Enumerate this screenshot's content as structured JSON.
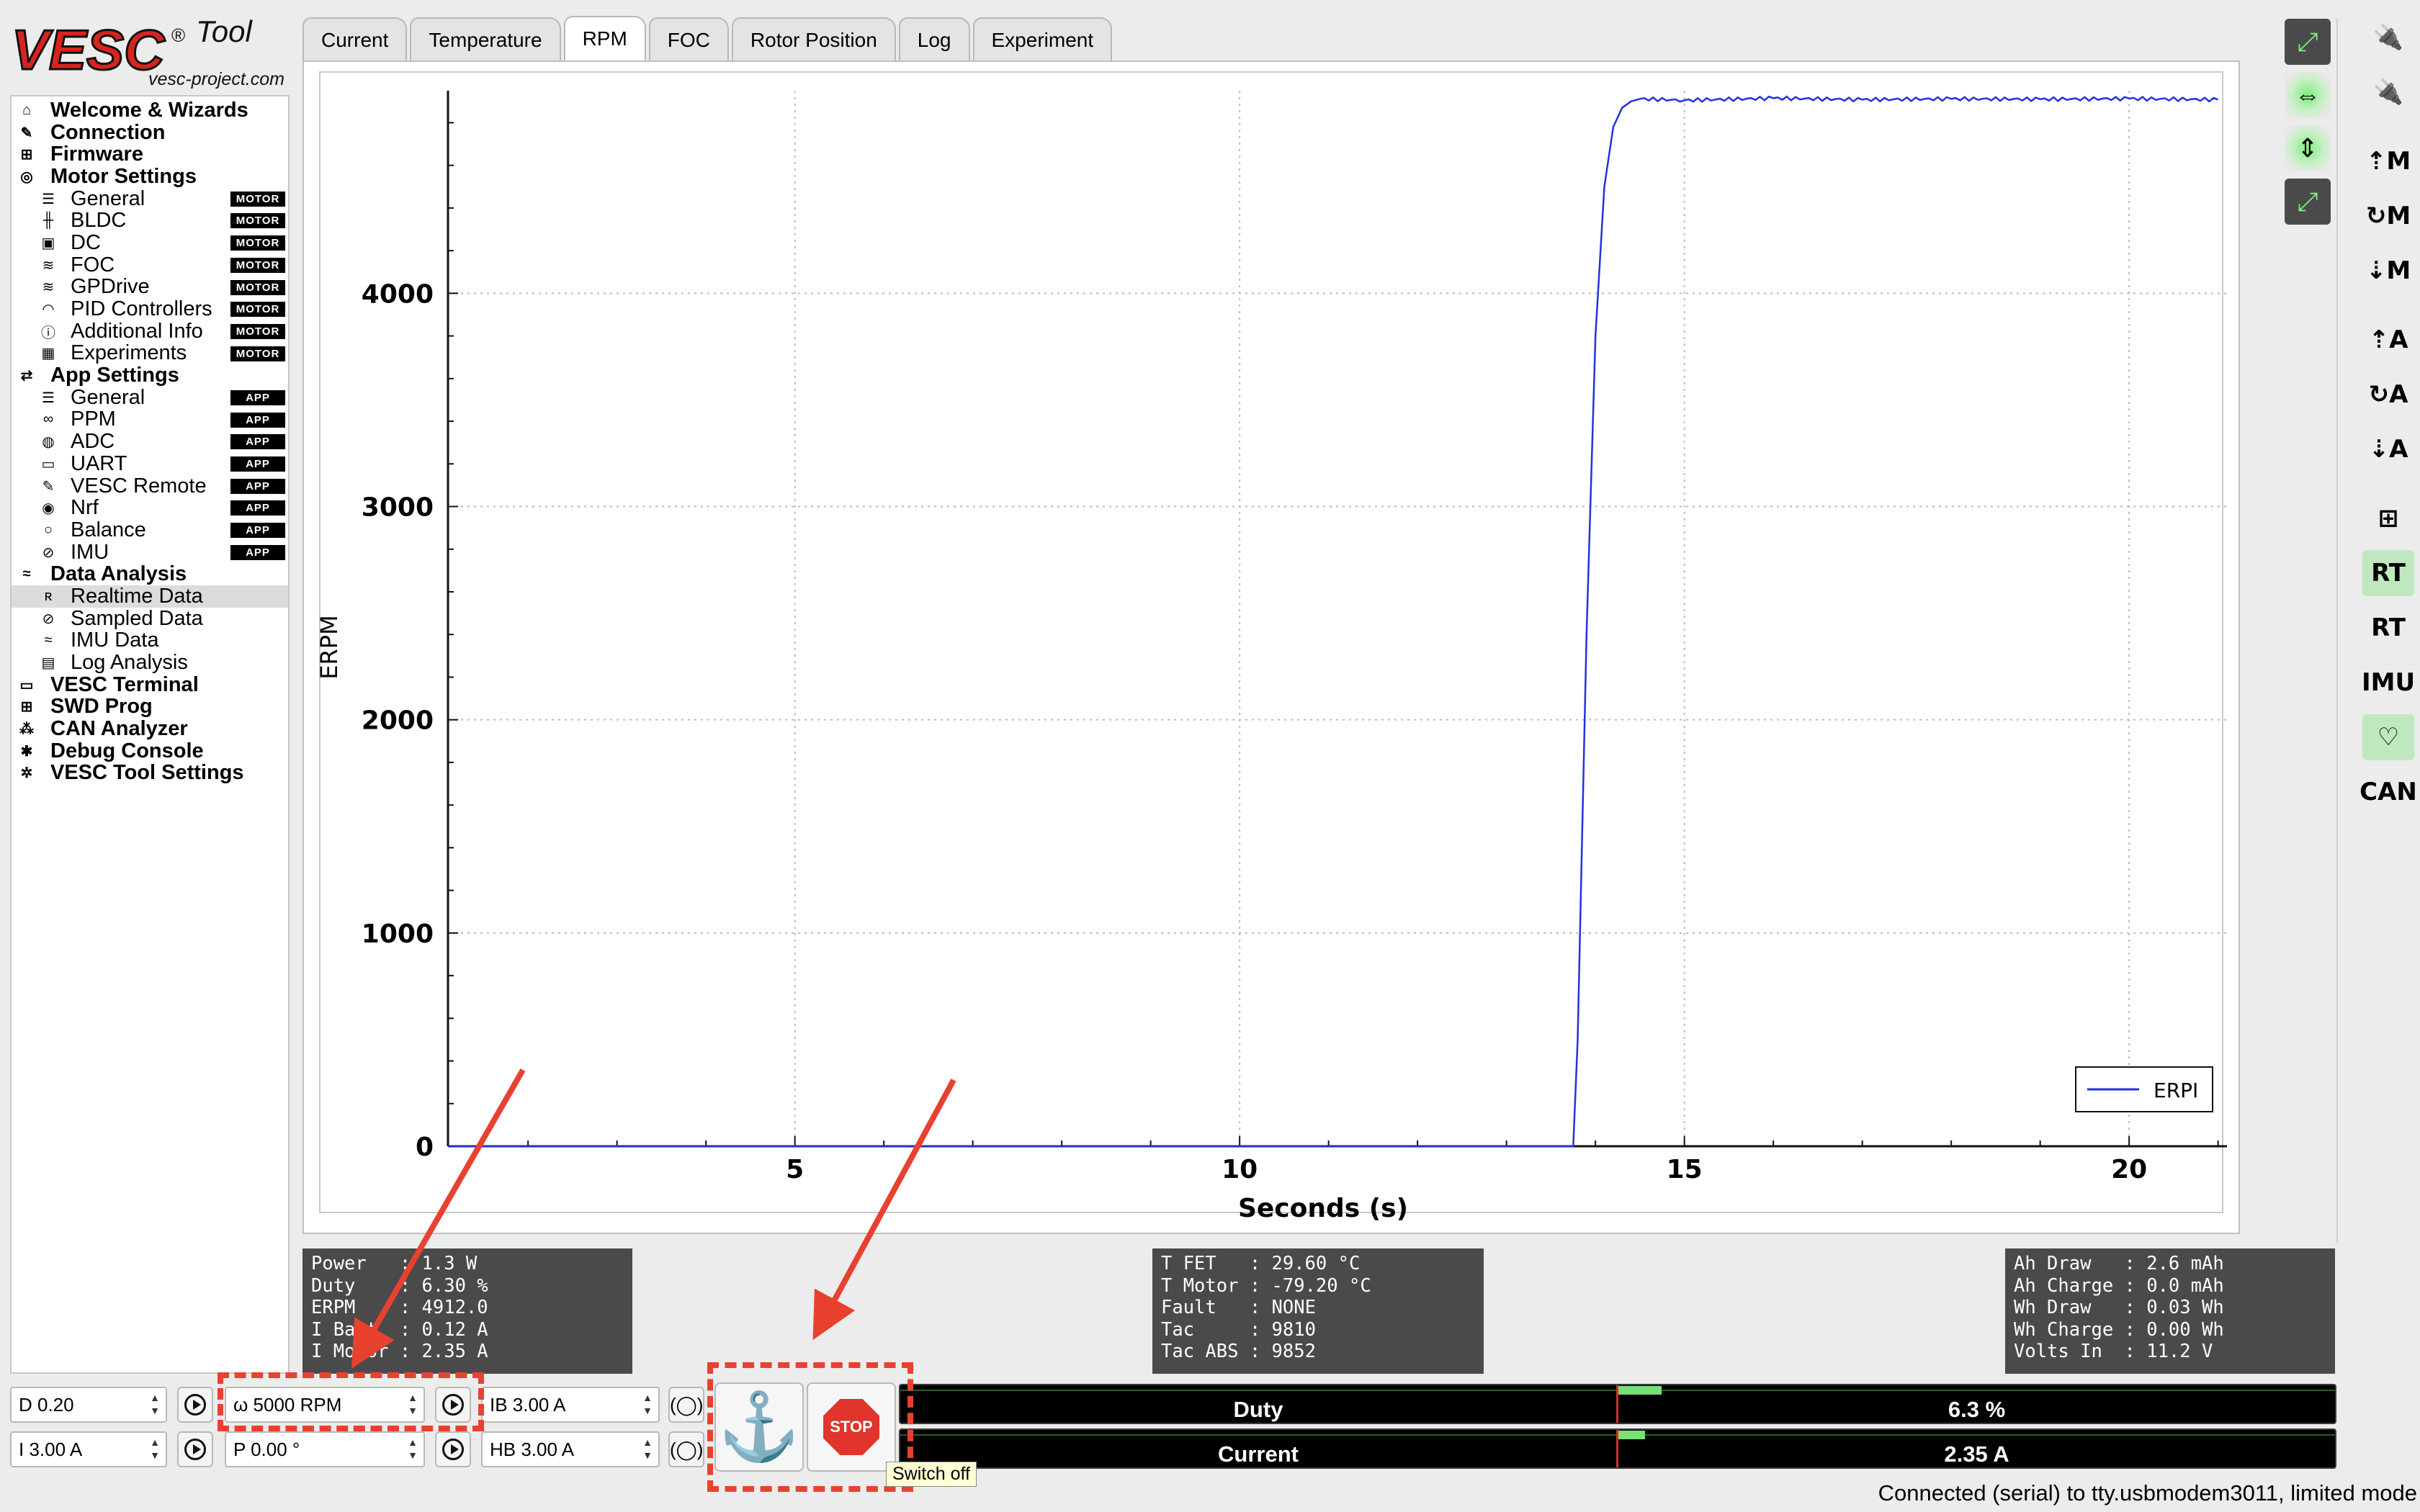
{
  "app": {
    "logo_main": "VESC",
    "logo_tool": "Tool",
    "logo_sub": "vesc-project.com"
  },
  "sidebar": {
    "items": [
      {
        "label": "Welcome & Wizards",
        "level": 1,
        "icon": "home-icon",
        "glyph": "⌂",
        "badge": ""
      },
      {
        "label": "Connection",
        "level": 1,
        "icon": "plug-icon",
        "glyph": "✎",
        "badge": ""
      },
      {
        "label": "Firmware",
        "level": 1,
        "icon": "chip-icon",
        "glyph": "⊞",
        "badge": ""
      },
      {
        "label": "Motor Settings",
        "level": 1,
        "icon": "motor-icon",
        "glyph": "◎",
        "badge": ""
      },
      {
        "label": "General",
        "level": 2,
        "icon": "sliders-icon",
        "glyph": "☰",
        "badge": "MOTOR"
      },
      {
        "label": "BLDC",
        "level": 2,
        "icon": "bldc-icon",
        "glyph": "╫",
        "badge": "MOTOR"
      },
      {
        "label": "DC",
        "level": 2,
        "icon": "dc-icon",
        "glyph": "▣",
        "badge": "MOTOR"
      },
      {
        "label": "FOC",
        "level": 2,
        "icon": "foc-icon",
        "glyph": "≋",
        "badge": "MOTOR"
      },
      {
        "label": "GPDrive",
        "level": 2,
        "icon": "gpdrive-icon",
        "glyph": "≋",
        "badge": "MOTOR"
      },
      {
        "label": "PID Controllers",
        "level": 2,
        "icon": "gauge-icon",
        "glyph": "◠",
        "badge": "MOTOR"
      },
      {
        "label": "Additional Info",
        "level": 2,
        "icon": "info-icon",
        "glyph": "ⓘ",
        "badge": "MOTOR"
      },
      {
        "label": "Experiments",
        "level": 2,
        "icon": "calculator-icon",
        "glyph": "▦",
        "badge": "MOTOR"
      },
      {
        "label": "App Settings",
        "level": 1,
        "icon": "arrows-icon",
        "glyph": "⇄",
        "badge": ""
      },
      {
        "label": "General",
        "level": 2,
        "icon": "sliders-icon",
        "glyph": "☰",
        "badge": "APP"
      },
      {
        "label": "PPM",
        "level": 2,
        "icon": "ppm-icon",
        "glyph": "∞",
        "badge": "APP"
      },
      {
        "label": "ADC",
        "level": 2,
        "icon": "adc-icon",
        "glyph": "◍",
        "badge": "APP"
      },
      {
        "label": "UART",
        "level": 2,
        "icon": "uart-icon",
        "glyph": "▭",
        "badge": "APP"
      },
      {
        "label": "VESC Remote",
        "level": 2,
        "icon": "remote-icon",
        "glyph": "✎",
        "badge": "APP"
      },
      {
        "label": "Nrf",
        "level": 2,
        "icon": "wireless-icon",
        "glyph": "◉",
        "badge": "APP"
      },
      {
        "label": "Balance",
        "level": 2,
        "icon": "balance-icon",
        "glyph": "○",
        "badge": "APP"
      },
      {
        "label": "IMU",
        "level": 2,
        "icon": "imu-icon",
        "glyph": "⊘",
        "badge": "APP"
      },
      {
        "label": "Data Analysis",
        "level": 1,
        "icon": "waveform-icon",
        "glyph": "≈",
        "badge": ""
      },
      {
        "label": "Realtime Data",
        "level": 2,
        "icon": "realtime-icon",
        "glyph": "ʀ",
        "badge": "",
        "selected": true
      },
      {
        "label": "Sampled Data",
        "level": 2,
        "icon": "sampled-icon",
        "glyph": "⊘",
        "badge": ""
      },
      {
        "label": "IMU Data",
        "level": 2,
        "icon": "imu-data-icon",
        "glyph": "≈",
        "badge": ""
      },
      {
        "label": "Log Analysis",
        "level": 2,
        "icon": "log-icon",
        "glyph": "▤",
        "badge": ""
      },
      {
        "label": "VESC Terminal",
        "level": 1,
        "icon": "terminal-icon",
        "glyph": "▭",
        "badge": ""
      },
      {
        "label": "SWD Prog",
        "level": 1,
        "icon": "chip-icon",
        "glyph": "⊞",
        "badge": ""
      },
      {
        "label": "CAN Analyzer",
        "level": 1,
        "icon": "can-icon",
        "glyph": "⁂",
        "badge": ""
      },
      {
        "label": "Debug Console",
        "level": 1,
        "icon": "bug-icon",
        "glyph": "✱",
        "badge": ""
      },
      {
        "label": "VESC Tool Settings",
        "level": 1,
        "icon": "gear-icon",
        "glyph": "✲",
        "badge": ""
      }
    ]
  },
  "tabs": [
    {
      "label": "Current"
    },
    {
      "label": "Temperature"
    },
    {
      "label": "RPM",
      "active": true
    },
    {
      "label": "FOC"
    },
    {
      "label": "Rotor Position"
    },
    {
      "label": "Log"
    },
    {
      "label": "Experiment"
    }
  ],
  "chart_data": {
    "type": "line",
    "xlabel": "Seconds (s)",
    "ylabel": "ERPM",
    "xlim": [
      1.1,
      21.1
    ],
    "ylim": [
      0,
      4950
    ],
    "xticks": [
      5,
      10,
      15,
      20
    ],
    "yticks": [
      0,
      1000,
      2000,
      3000,
      4000
    ],
    "grid": true,
    "legend_position": "bottom-right",
    "series": [
      {
        "name": "ERPI",
        "color": "#2233dd",
        "x": [
          1.1,
          13.75,
          13.8,
          13.9,
          14.0,
          14.1,
          14.2,
          14.3,
          14.4,
          14.5,
          15.0,
          16.0,
          17.0,
          18.0,
          19.0,
          20.0,
          21.0
        ],
        "y": [
          0,
          0,
          500,
          2400,
          3800,
          4500,
          4780,
          4870,
          4900,
          4912,
          4905,
          4915,
          4908,
          4912,
          4910,
          4913,
          4908
        ]
      }
    ]
  },
  "toolbar_right_a": [
    {
      "icon": "zoom-auto-icon",
      "glyph": "⤢",
      "style": "on"
    },
    {
      "icon": "zoom-horizontal-icon",
      "glyph": "⇔",
      "style": "glow"
    },
    {
      "icon": "zoom-vertical-icon",
      "glyph": "⇕",
      "style": "glow"
    },
    {
      "icon": "rescale-icon",
      "glyph": "⤢",
      "style": "on"
    }
  ],
  "toolbar_right_b": [
    {
      "icon": "connect-icon",
      "glyph": "🔌"
    },
    {
      "icon": "disconnect-icon",
      "glyph": "🔌"
    },
    {
      "icon": "read-motor-config-icon",
      "glyph": "⇡M"
    },
    {
      "icon": "read-default-motor-config-icon",
      "glyph": "↻M"
    },
    {
      "icon": "write-motor-config-icon",
      "glyph": "⇣M"
    },
    {
      "icon": "read-app-config-icon",
      "glyph": "⇡A"
    },
    {
      "icon": "read-default-app-config-icon",
      "glyph": "↻A"
    },
    {
      "icon": "write-app-config-icon",
      "glyph": "⇣A"
    },
    {
      "icon": "can-network-icon",
      "glyph": "⊞"
    },
    {
      "icon": "realtime-stream-icon",
      "glyph": "RT",
      "style": "green"
    },
    {
      "icon": "realtime-app-icon",
      "glyph": "RT"
    },
    {
      "icon": "imu-stream-icon",
      "glyph": "IMU"
    },
    {
      "icon": "heartbeat-icon",
      "glyph": "♡",
      "style": "green"
    },
    {
      "icon": "can-forward-icon",
      "glyph": "CAN"
    }
  ],
  "stats": {
    "a": "Power   : 1.3 W\nDuty    : 6.30 %\nERPM    : 4912.0\nI Batt  : 0.12 A\nI Motor : 2.35 A",
    "b": "T FET   : 29.60 °C\nT Motor : -79.20 °C\nFault   : NONE\nTac     : 9810\nTac ABS : 9852",
    "c": "Ah Draw   : 2.6 mAh\nAh Charge : 0.0 mAh\nWh Draw   : 0.03 Wh\nWh Charge : 0.00 Wh\nVolts In  : 11.2 V"
  },
  "controls": {
    "duty_value": "D 0.20",
    "current_value": "I 3.00 A",
    "rpm_value": "ω 5000 RPM",
    "position_value": "P 0.00 °",
    "brake_current_value": "IB 3.00 A",
    "handbrake_value": "HB 3.00 A",
    "stop_label": "STOP",
    "anchor_glyph": "⚓",
    "tooltip": "Switch off"
  },
  "gauges": {
    "duty": {
      "name": "Duty",
      "value_text": "6.3 %",
      "fraction": 0.063
    },
    "current": {
      "name": "Current",
      "value_text": "2.35 A",
      "fraction": 0.04
    }
  },
  "status": "Connected (serial) to tty.usbmodem3011, limited mode",
  "annotation_color": "#e8412f"
}
